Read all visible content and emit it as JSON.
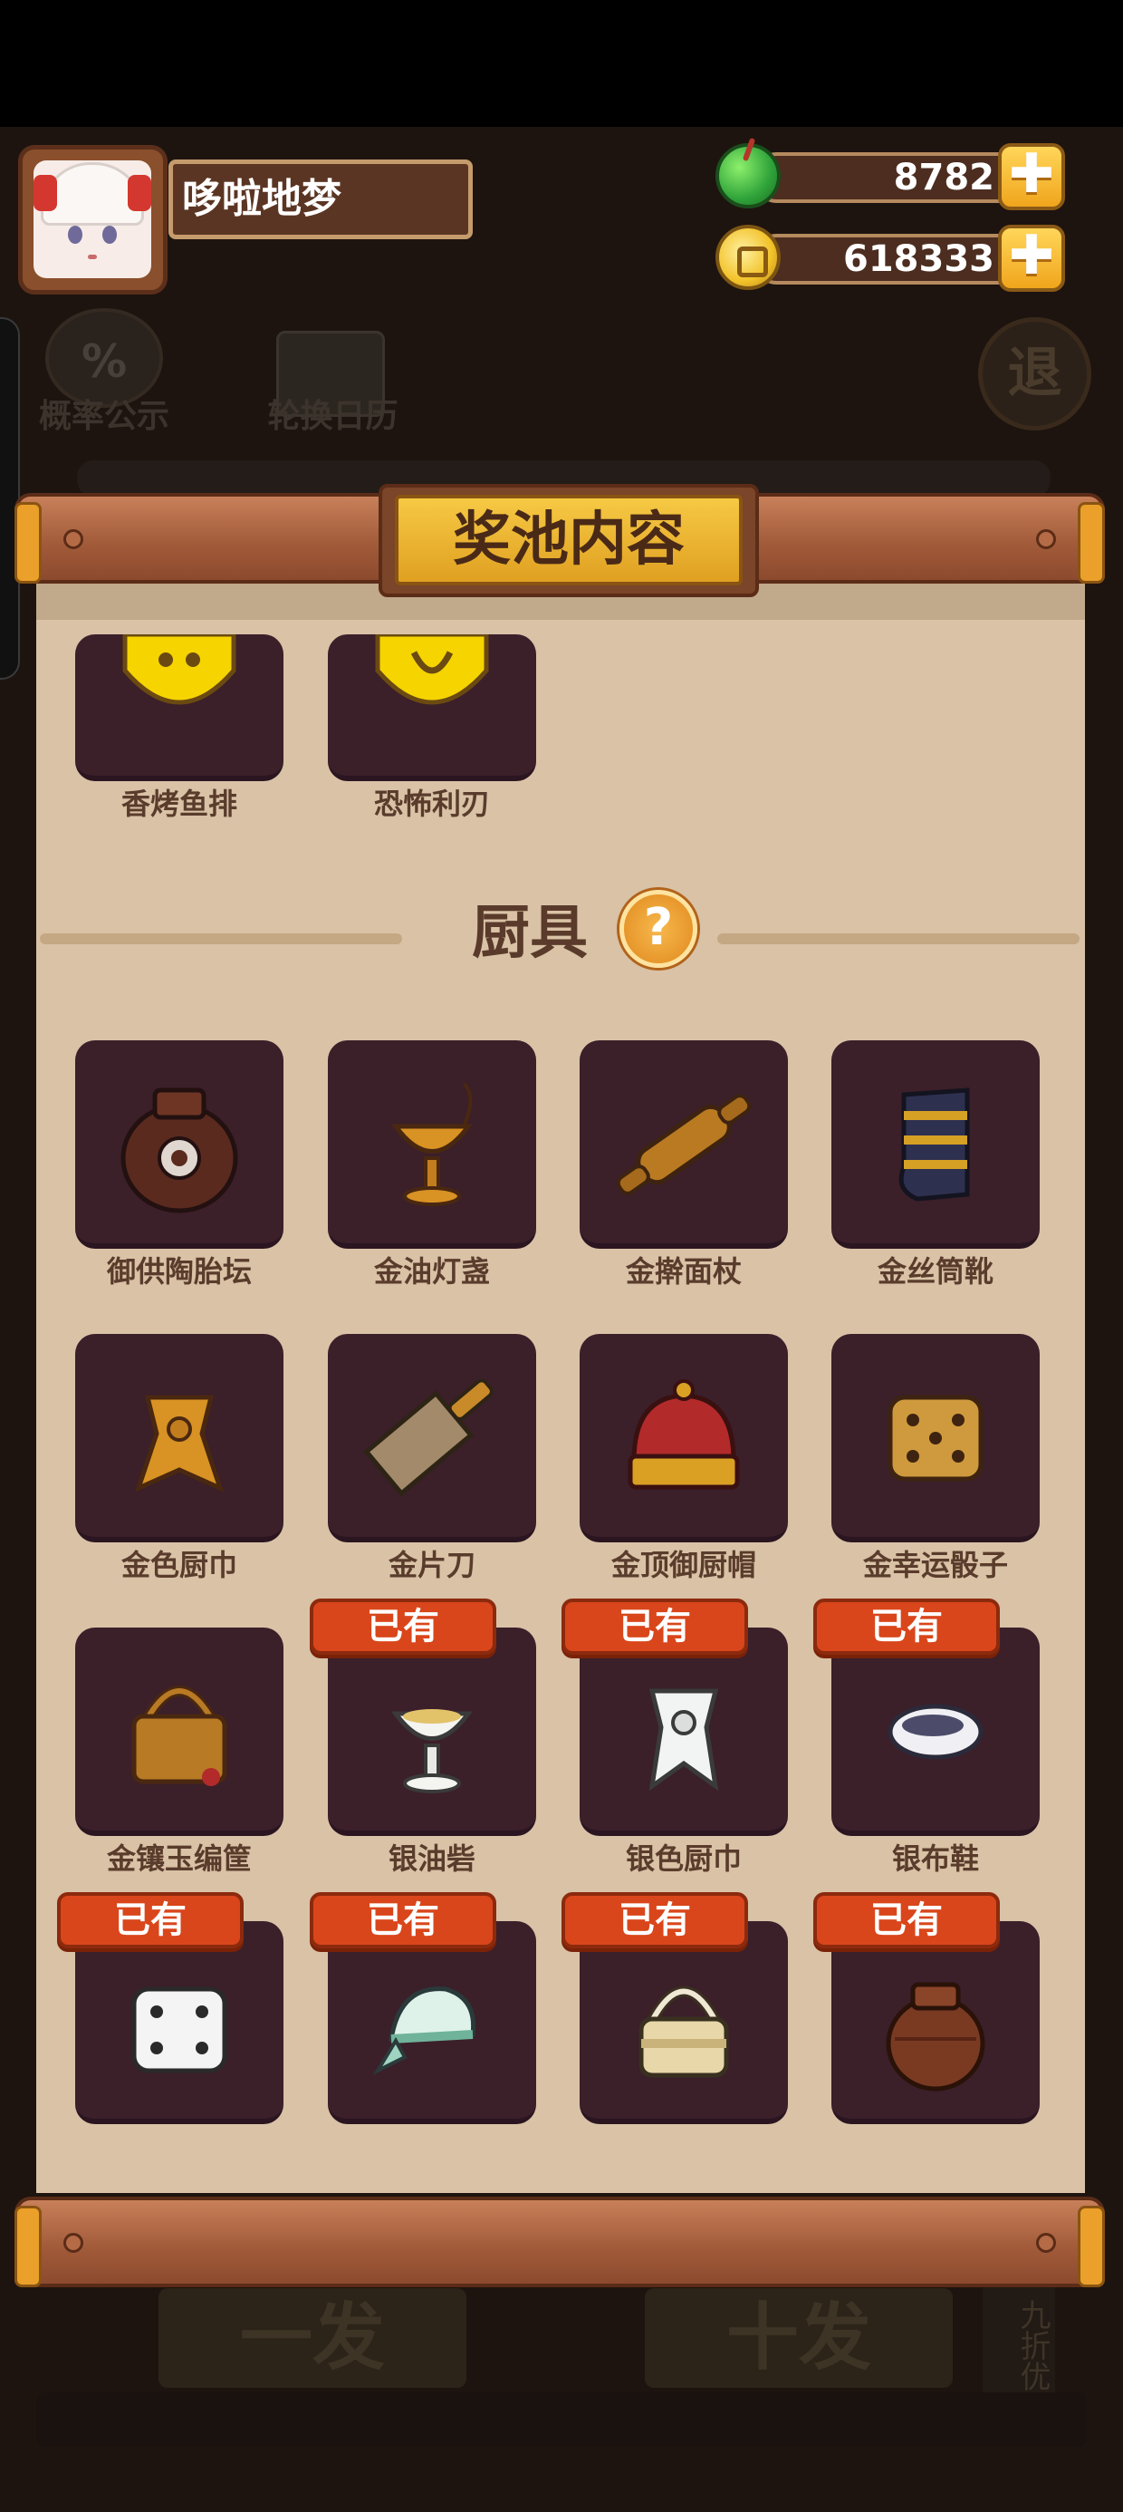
{
  "header": {
    "player_name": "哆啦地梦",
    "gems": "8782",
    "coins": "618333",
    "plus": "✚"
  },
  "background": {
    "probability_label": "概率公示",
    "calendar_label": "轮换日历",
    "exit_label": "退",
    "single_draw": "一发",
    "ten_draw": "十发",
    "discount_tag": "九折优惠",
    "cog_symbol": "%"
  },
  "modal": {
    "title": "奖池内容",
    "section_title": "厨具",
    "help_symbol": "?",
    "owned_label": "已有",
    "top_items": [
      {
        "label": "香烤鱼排",
        "icon": "gold-fish-icon"
      },
      {
        "label": "恐怖利刃",
        "icon": "gold-blade-icon"
      }
    ],
    "kitchenware": [
      {
        "label": "御供陶胎坛",
        "icon": "clay-jar-icon",
        "owned": false
      },
      {
        "label": "金油灯盏",
        "icon": "gold-oil-lamp-icon",
        "owned": false
      },
      {
        "label": "金擀面杖",
        "icon": "gold-rolling-pin-icon",
        "owned": false
      },
      {
        "label": "金丝筒靴",
        "icon": "gold-boots-icon",
        "owned": false
      },
      {
        "label": "金色厨巾",
        "icon": "gold-scarf-icon",
        "owned": false
      },
      {
        "label": "金片刀",
        "icon": "gold-cleaver-icon",
        "owned": false
      },
      {
        "label": "金顶御厨帽",
        "icon": "gold-chef-hat-icon",
        "owned": false
      },
      {
        "label": "金幸运骰子",
        "icon": "gold-dice-icon",
        "owned": false
      },
      {
        "label": "金镶玉编筐",
        "icon": "gold-basket-icon",
        "owned": false
      },
      {
        "label": "银油砦",
        "icon": "silver-oil-lamp-icon",
        "owned": true
      },
      {
        "label": "银色厨巾",
        "icon": "silver-scarf-icon",
        "owned": true
      },
      {
        "label": "银布鞋",
        "icon": "silver-shoe-icon",
        "owned": true
      },
      {
        "label": "",
        "icon": "white-dice-icon",
        "owned": true
      },
      {
        "label": "",
        "icon": "cloth-cap-icon",
        "owned": true
      },
      {
        "label": "",
        "icon": "woven-basket-icon",
        "owned": true
      },
      {
        "label": "",
        "icon": "brown-jar-icon",
        "owned": true
      }
    ]
  },
  "colors": {
    "card_bg": "#3b1f29",
    "parchment": "#d9c2a6",
    "owned_badge": "#d9461b",
    "title_gold": "#f0b833"
  }
}
